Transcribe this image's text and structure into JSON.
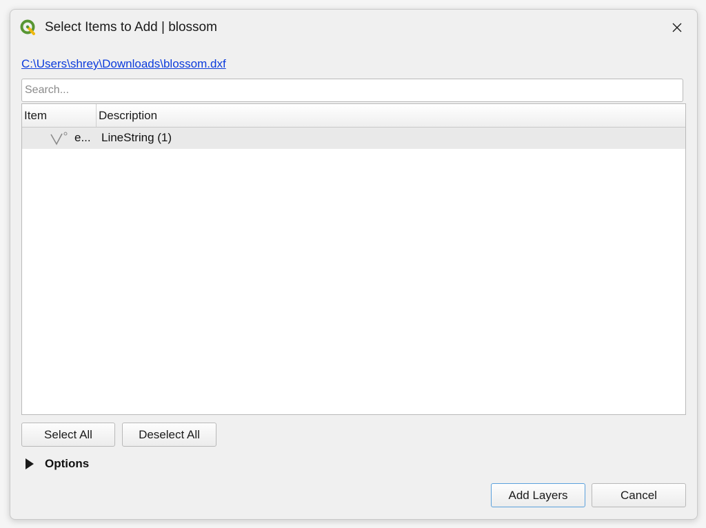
{
  "window": {
    "title": "Select Items to Add | blossom",
    "app_icon": "qgis-icon",
    "close_icon": "close-icon"
  },
  "file_path": "C:\\Users\\shrey\\Downloads\\blossom.dxf",
  "search": {
    "placeholder": "Search...",
    "value": ""
  },
  "tree": {
    "columns": [
      "Item",
      "Description"
    ],
    "rows": [
      {
        "icon": "linestring-icon",
        "item": "e...",
        "description": "LineString (1)"
      }
    ]
  },
  "buttons": {
    "select_all": "Select All",
    "deselect_all": "Deselect All",
    "add_layers": "Add Layers",
    "cancel": "Cancel"
  },
  "options": {
    "label": "Options",
    "expanded": false
  },
  "colors": {
    "link": "#0b3bdc",
    "qgis_green": "#589632",
    "default_button_border": "#5aa0dc",
    "row_selected": "#e9e9e9"
  }
}
